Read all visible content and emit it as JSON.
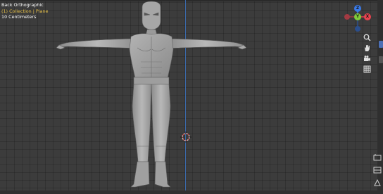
{
  "viewport": {
    "view_name": "Back Orthographic",
    "collection": "(1) Collection | Plane",
    "scale": "10 Centimeters"
  },
  "gizmo": {
    "axes": [
      {
        "label": "Z",
        "color": "#3a79e6"
      },
      {
        "label": "X",
        "color": "#e8434f"
      },
      {
        "label": "Y",
        "color": "#7fcb3a"
      }
    ]
  },
  "tools": [
    {
      "name": "zoom",
      "icon": "zoom-icon"
    },
    {
      "name": "pan",
      "icon": "hand-icon"
    },
    {
      "name": "camera",
      "icon": "camera-icon"
    },
    {
      "name": "orthographic-toggle",
      "icon": "grid-icon"
    }
  ],
  "colors": {
    "grid_background": "#3c3c3c",
    "axis_line": "#3b6fb8",
    "collection_text": "#e7c24a"
  }
}
